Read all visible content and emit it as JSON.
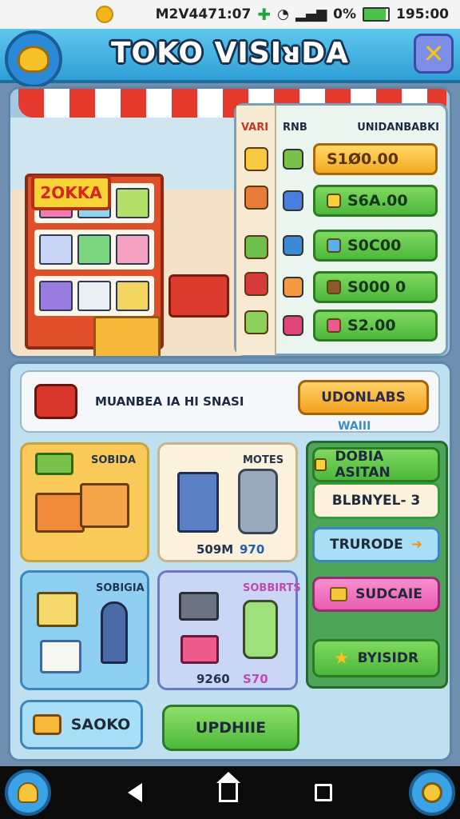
{
  "status_bar": {
    "left_text": "M2V4471:07",
    "battery": "0%",
    "time": "195:00"
  },
  "header": {
    "title": "TOKO VISIᴚDA",
    "close_glyph": "✕"
  },
  "scene": {
    "shop_sign": "2OKKA",
    "board": {
      "side_label": "VARI",
      "col1": "RNB",
      "col2": "UNIDANBABKI"
    },
    "price_buttons": [
      {
        "label": "S1Ø0.00",
        "style": "gold"
      },
      {
        "label": "S6A.00",
        "style": "green"
      },
      {
        "label": "S0C00",
        "style": "green"
      },
      {
        "label": "S000 0",
        "style": "green"
      },
      {
        "label": "S2.00",
        "style": "green"
      }
    ]
  },
  "mission": {
    "text": "MUANBEA IA HI SNASI",
    "button": "UDONLABS",
    "sub": "WAIII"
  },
  "tiles": {
    "t1": {
      "label": "SOBIDA"
    },
    "t2": {
      "label": "MOTES",
      "left_value": "509M",
      "right_value": "970"
    },
    "t3": {
      "label": "SOBIGIA"
    },
    "t4": {
      "label": "SOBBIRTS",
      "left_value": "9260",
      "right_value": "S70"
    }
  },
  "side_buttons": {
    "b1": "DOBIA ASITAN",
    "b2": "BLBNYEL- 3",
    "b3": "TRURODE",
    "b4": "SUDCAIE",
    "b5": "BYISIDR"
  },
  "bottom": {
    "left": "SAOKO",
    "right": "UPDHIIE"
  },
  "colors": {
    "accent_blue": "#2f9fd6",
    "green_button": "#4db83b",
    "gold_button": "#f3aa22",
    "pink_button": "#f05cb4"
  }
}
